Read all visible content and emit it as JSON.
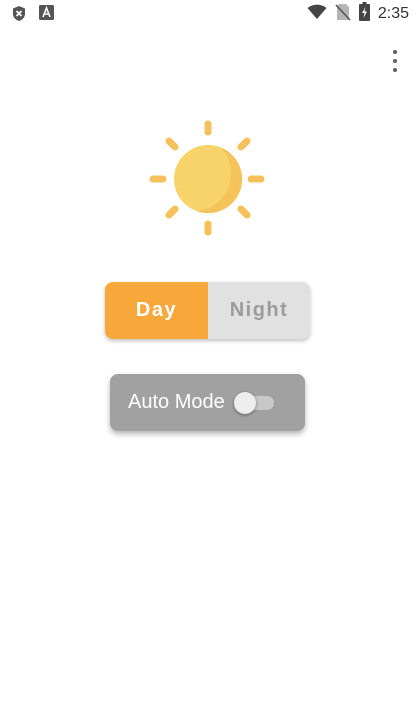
{
  "status_bar": {
    "time": "2:35",
    "left_icons": [
      "x-circle-icon",
      "a-square-icon"
    ],
    "right_icons": [
      "wifi-icon",
      "no-sim-icon",
      "battery-charging-icon"
    ]
  },
  "toolbar": {
    "overflow_icon": "more-vertical-icon"
  },
  "hero": {
    "icon": "sun-icon",
    "sun_color": "#f8d36a",
    "ray_color": "#f6c15a"
  },
  "mode_toggle": {
    "options": [
      "Day",
      "Night"
    ],
    "selected": "Day",
    "selected_color": "#f8a73a",
    "unselected_color": "#e1e1e1"
  },
  "auto_mode": {
    "label": "Auto Mode",
    "enabled": false,
    "background": "#a1a1a1"
  }
}
